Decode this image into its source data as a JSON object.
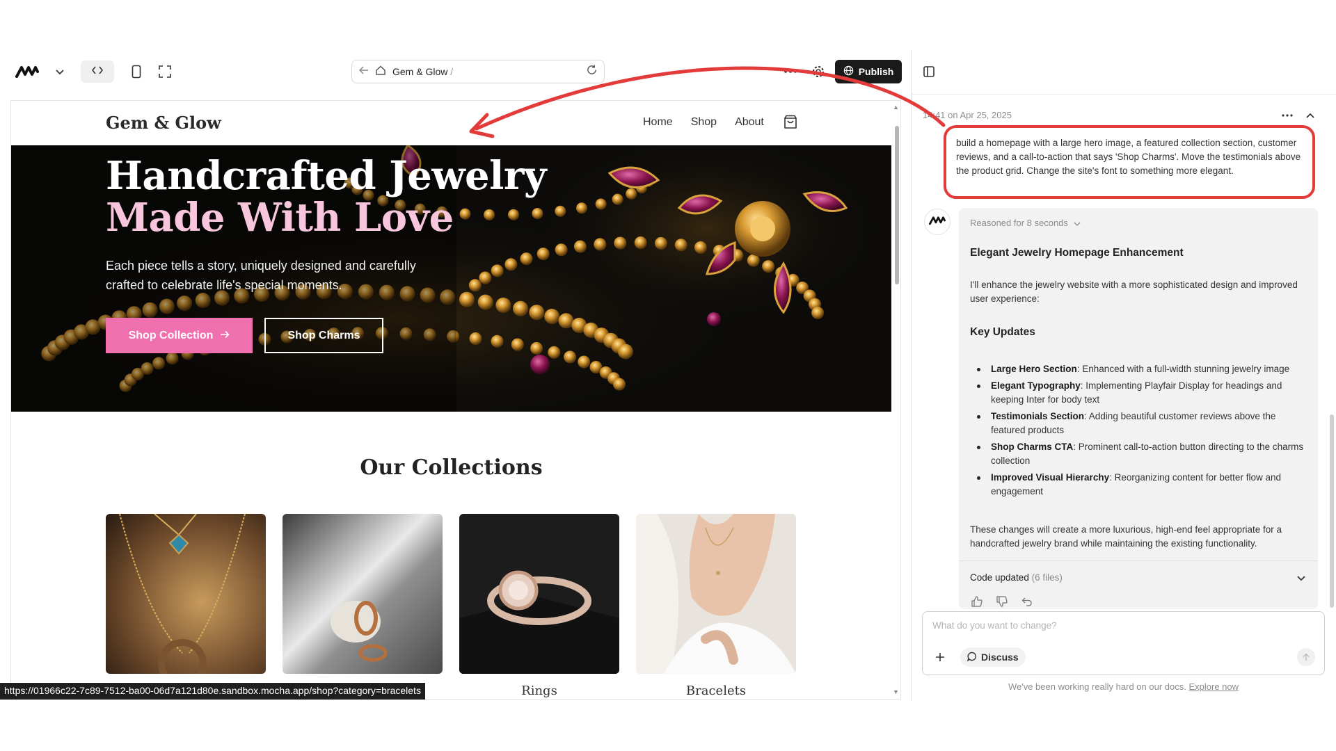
{
  "toolbar": {
    "url_site": "Gem & Glow",
    "url_path": "/",
    "publish_label": "Publish"
  },
  "site": {
    "logo": "Gem & Glow",
    "nav": [
      "Home",
      "Shop",
      "About"
    ],
    "hero": {
      "title_line1": "Handcrafted Jewelry",
      "title_line2": "Made With Love",
      "subtitle": "Each piece tells a story, uniquely designed and carefully crafted to celebrate life's special moments.",
      "primary_button": "Shop Collection",
      "secondary_button": "Shop Charms"
    },
    "collections_title": "Our Collections",
    "collections": [
      {
        "label": ""
      },
      {
        "label": ""
      },
      {
        "label": "Rings"
      },
      {
        "label": "Bracelets"
      }
    ]
  },
  "status_url": "https://01966c22-7c89-7512-ba00-06d7a121d80e.sandbox.mocha.app/shop?category=bracelets",
  "chat": {
    "timestamp": "14:41 on Apr 25, 2025",
    "user_message": "build a homepage with a large hero image, a featured collection section, customer reviews, and a call-to-action that says 'Shop Charms'. Move the testimonials above the product grid. Change the site's font to something more elegant.",
    "reasoned": "Reasoned for 8 seconds",
    "title": "Elegant Jewelry Homepage Enhancement",
    "intro": "I'll enhance the jewelry website with a more sophisticated design and improved user experience:",
    "section_heading": "Key Updates",
    "updates": [
      {
        "bold": "Large Hero Section",
        "text": ": Enhanced with a full-width stunning jewelry image"
      },
      {
        "bold": "Elegant Typography",
        "text": ": Implementing Playfair Display for headings and keeping Inter for body text"
      },
      {
        "bold": "Testimonials Section",
        "text": ": Adding beautiful customer reviews above the featured products"
      },
      {
        "bold": "Shop Charms CTA",
        "text": ": Prominent call-to-action button directing to the charms collection"
      },
      {
        "bold": "Improved Visual Hierarchy",
        "text": ": Reorganizing content for better flow and engagement"
      }
    ],
    "outro": "These changes will create a more luxurious, high-end feel appropriate for a handcrafted jewelry brand while maintaining the existing functionality.",
    "code_updated": "Code updated",
    "code_files": "(6 files)",
    "prompt_placeholder": "What do you want to change?",
    "discuss_label": "Discuss",
    "docs_note": "We've been working really hard on our docs.",
    "docs_link": "Explore now"
  },
  "colors": {
    "accent_pink": "#f06fae",
    "hero_pink_text": "#f7c6dc",
    "annotation_red": "#e33a3a",
    "publish_bg": "#1a1a1a"
  },
  "icons": [
    "logo-icon",
    "chevron-down-icon",
    "code-icon",
    "mobile-icon",
    "fullscreen-icon",
    "back-arrow-icon",
    "home-icon",
    "refresh-icon",
    "more-icon",
    "gear-icon",
    "globe-icon",
    "panel-toggle-icon",
    "cart-icon",
    "arrow-right-icon",
    "chevron-up-icon",
    "thumbs-up-icon",
    "thumbs-down-icon",
    "undo-icon",
    "plus-icon",
    "chat-bubble-icon",
    "send-arrow-icon"
  ]
}
